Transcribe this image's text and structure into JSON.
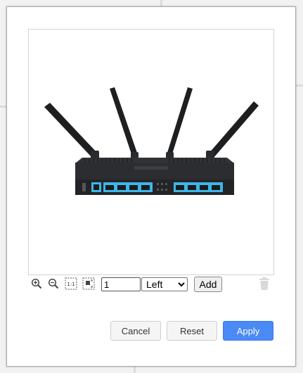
{
  "toolbar": {
    "icons": [
      "zoom-in-icon",
      "zoom-out-icon",
      "actual-size-icon",
      "fit-to-frame-icon",
      "trash-icon"
    ],
    "size_value": "1",
    "align_selected": "Left",
    "add_label": "Add"
  },
  "footer": {
    "cancel_label": "Cancel",
    "reset_label": "Reset",
    "apply_label": "Apply"
  },
  "colors": {
    "accent": "#4a8af4",
    "port_blue": "#3fb6e8",
    "router_body": "#2b2d30"
  }
}
